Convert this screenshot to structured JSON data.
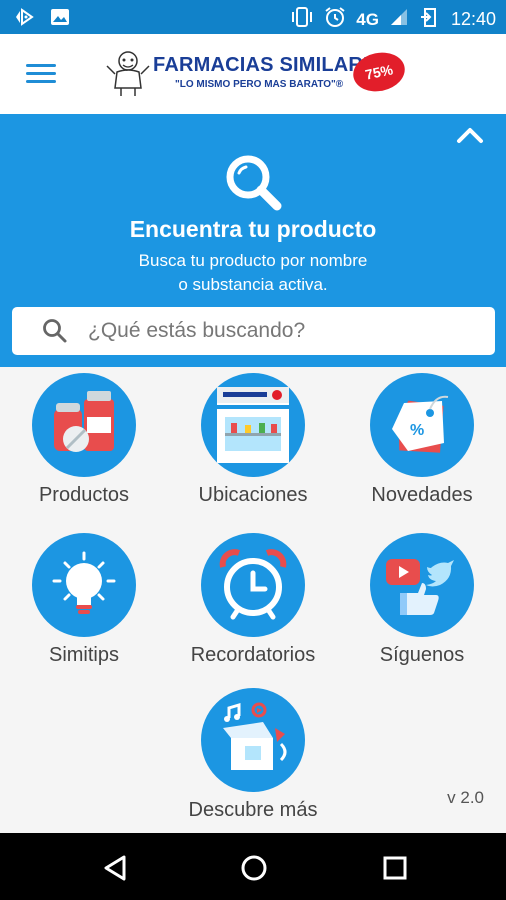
{
  "status_bar": {
    "network": "4G",
    "time": "12:40",
    "icons": [
      "media-play-icon",
      "image-icon",
      "vibrate-icon",
      "alarm-icon",
      "signal-icon",
      "battery-charging-icon"
    ]
  },
  "app_bar": {
    "brand_name": "FARMACIAS SIMILARES",
    "registered_mark": "®",
    "slogan": "\"LO MISMO PERO MAS BARATO\"®",
    "badge_text": "75%",
    "menu_icon": "hamburger-menu-icon"
  },
  "hero": {
    "title": "Encuentra tu producto",
    "subtitle_line1": "Busca tu producto por nombre",
    "subtitle_line2": "o substancia activa.",
    "search_placeholder": "¿Qué estás buscando?",
    "collapse_icon": "chevron-up-icon",
    "accent_color": "#1c96e2"
  },
  "menu": {
    "items": [
      {
        "label": "Productos",
        "icon": "medicine-bottles-icon"
      },
      {
        "label": "Ubicaciones",
        "icon": "pharmacy-store-icon"
      },
      {
        "label": "Novedades",
        "icon": "discount-tag-icon"
      },
      {
        "label": "Simitips",
        "icon": "lightbulb-icon"
      },
      {
        "label": "Recordatorios",
        "icon": "alarm-clock-icon"
      },
      {
        "label": "Síguenos",
        "icon": "social-media-icon"
      },
      {
        "label": "Descubre más",
        "icon": "discover-box-icon"
      }
    ]
  },
  "footer": {
    "version": "v 2.0"
  },
  "nav_bar": {
    "icons": [
      "back-icon",
      "home-icon",
      "recents-icon"
    ]
  }
}
